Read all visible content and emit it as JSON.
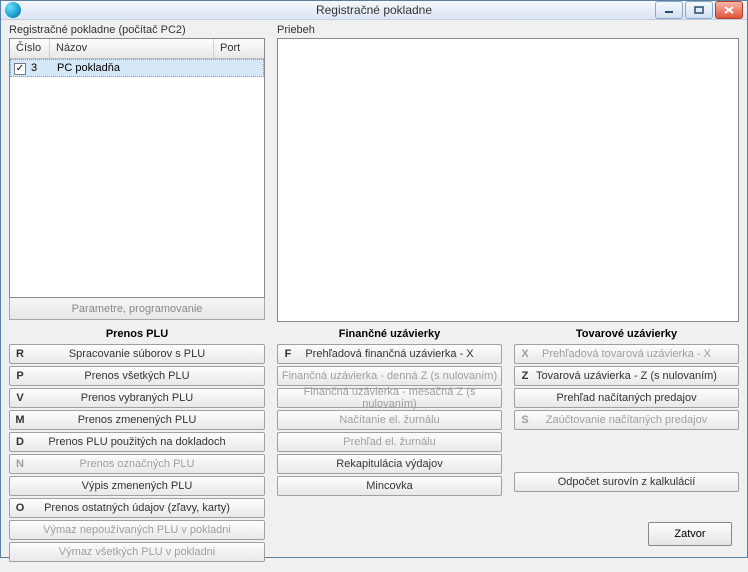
{
  "window": {
    "title": "Registračné pokladne"
  },
  "left_panel": {
    "label": "Registračné pokladne (počítač PC2)",
    "columns": {
      "cislo": "Číslo",
      "nazov": "Názov",
      "port": "Port"
    },
    "rows": [
      {
        "checked": true,
        "cislo": "3",
        "nazov": "PC pokladňa",
        "port": ""
      }
    ],
    "params_button": "Parametre, programovanie"
  },
  "right_panel": {
    "label": "Priebeh"
  },
  "prenos": {
    "title": "Prenos PLU",
    "buttons": [
      {
        "key": "R",
        "label": "Spracovanie súborov s PLU",
        "enabled": true
      },
      {
        "key": "P",
        "label": "Prenos všetkých PLU",
        "enabled": true
      },
      {
        "key": "V",
        "label": "Prenos vybraných PLU",
        "enabled": true
      },
      {
        "key": "M",
        "label": "Prenos zmenených PLU",
        "enabled": true
      },
      {
        "key": "D",
        "label": "Prenos PLU použitých na dokladoch",
        "enabled": true
      },
      {
        "key": "N",
        "label": "Prenos označných PLU",
        "enabled": false
      },
      {
        "key": "",
        "label": "Výpis zmenených PLU",
        "enabled": true
      },
      {
        "key": "O",
        "label": "Prenos ostatných údajov (zľavy, karty)",
        "enabled": true
      },
      {
        "key": "",
        "label": "Výmaz nepoužívaných PLU v pokladni",
        "enabled": false
      },
      {
        "key": "",
        "label": "Výmaz všetkých PLU v pokladni",
        "enabled": false
      }
    ]
  },
  "financne": {
    "title": "Finančné uzávierky",
    "buttons": [
      {
        "key": "F",
        "label": "Prehľadová finančná uzávierka - X",
        "enabled": true
      },
      {
        "key": "",
        "label": "Finančná uzávierka - denná Z (s nulovaním)",
        "enabled": false
      },
      {
        "key": "",
        "label": "Finančná uzávierka - mesačná Z (s nulovaním)",
        "enabled": false
      },
      {
        "key": "",
        "label": "Načítanie el. žurnálu",
        "enabled": false
      },
      {
        "key": "",
        "label": "Prehľad el. žurnálu",
        "enabled": false
      },
      {
        "key": "",
        "label": "Rekapitulácia výdajov",
        "enabled": true
      },
      {
        "key": "",
        "label": "Mincovka",
        "enabled": true
      }
    ]
  },
  "tovarove": {
    "title": "Tovarové uzávierky",
    "buttons": [
      {
        "key": "X",
        "label": "Prehľadová tovarová uzávierka - X",
        "enabled": false
      },
      {
        "key": "Z",
        "label": "Tovarová uzávierka - Z (s nulovaním)",
        "enabled": true
      },
      {
        "key": "",
        "label": "Prehľad načítaných predajov",
        "enabled": true
      },
      {
        "key": "S",
        "label": "Zaúčtovanie načítaných predajov",
        "enabled": false
      }
    ],
    "extra": {
      "label": "Odpočet surovín z kalkulácií",
      "enabled": true
    }
  },
  "footer": {
    "close": "Zatvor"
  }
}
